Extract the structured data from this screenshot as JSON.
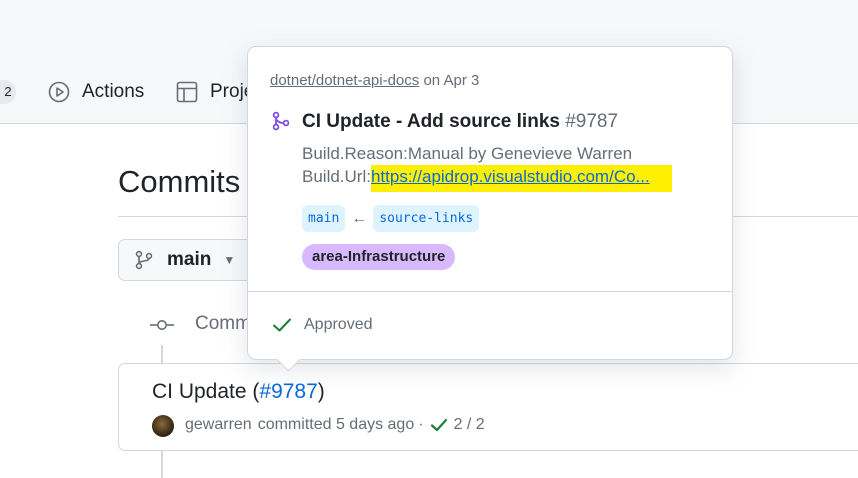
{
  "nav": {
    "count_badge": "2",
    "tabs": [
      {
        "label": "Actions",
        "icon": "play-icon"
      },
      {
        "label": "Proje",
        "icon": "table-icon"
      }
    ]
  },
  "page": {
    "title": "Commits",
    "branch": "main",
    "commits_on_label": "Comm"
  },
  "commit": {
    "title": "CI Update (",
    "pr_number": "#9787",
    "title_suffix": ")",
    "author": "gewarren",
    "action": "committed 5 days ago",
    "separator": "·",
    "checks": "2 / 2"
  },
  "popover": {
    "repo": "dotnet/dotnet-api-docs",
    "date": "on Apr 3",
    "pr_title": "CI Update - Add source links",
    "pr_number": "#9787",
    "body_line1": "Build.Reason:Manual by Genevieve Warren",
    "body_prefix": "Build.Url:",
    "body_url": "https://apidrop.visualstudio.com/Co...",
    "base_ref": "main",
    "ref_arrow": "←",
    "head_ref": "source-links",
    "label": "area-Infrastructure",
    "review_status": "Approved"
  },
  "colors": {
    "accent_blue": "#0969da",
    "merged_purple": "#8250df",
    "success_green": "#1a7f37",
    "highlight_yellow": "#ffef00",
    "label_purple": "#d8b9ff"
  }
}
